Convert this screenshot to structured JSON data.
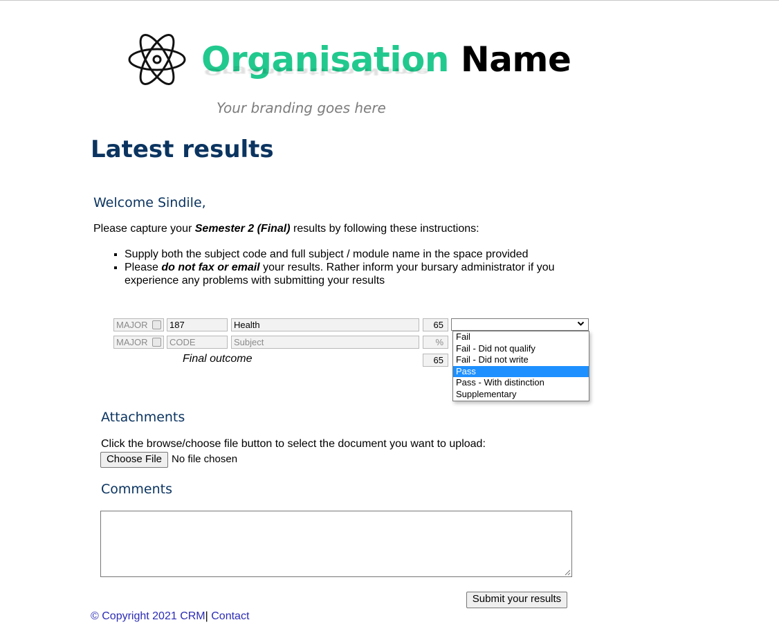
{
  "branding": {
    "org_word": "Organisation",
    "name_word": "Name",
    "tagline": "Your branding goes here"
  },
  "page_title": "Latest results",
  "welcome": "Welcome Sindile,",
  "instructions": {
    "prefix": "Please capture your ",
    "emphasis": "Semester 2 (Final)",
    "suffix": " results by following these instructions:"
  },
  "rules": [
    {
      "text": "Supply both the subject code and full subject / module name in the space provided"
    },
    {
      "prefix": "Please ",
      "emphasis": "do not fax or email",
      "suffix": " your results. Rather inform your bursary administrator if you experience any problems with submitting your results"
    }
  ],
  "results_rows": [
    {
      "type_label": "MAJOR",
      "code": "187",
      "subject": "Health",
      "mark": "65"
    },
    {
      "type_label": "MAJOR",
      "code_placeholder": "CODE",
      "subject_placeholder": "Subject",
      "mark_placeholder": "%"
    }
  ],
  "final_outcome": {
    "label": "Final outcome",
    "value": "65"
  },
  "outcome_select": {
    "selected": "",
    "options": [
      "Fail",
      "Fail - Did not qualify",
      "Fail - Did not write",
      "Pass",
      "Pass - With distinction",
      "Supplementary"
    ],
    "highlighted": "Pass"
  },
  "attachments": {
    "heading": "Attachments",
    "text": "Click the browse/choose file button to select the document you want to upload:",
    "button": "Choose File",
    "status": "No file chosen"
  },
  "comments": {
    "heading": "Comments",
    "value": ""
  },
  "submit_label": "Submit your results",
  "footer": {
    "copyright": "© Copyright 2021 CRM",
    "separator": "|",
    "contact": "Contact"
  },
  "colors": {
    "brand_green": "#22c98e",
    "heading_navy": "#0b3460",
    "link": "#2b2bb6",
    "highlight": "#1e90ff"
  }
}
